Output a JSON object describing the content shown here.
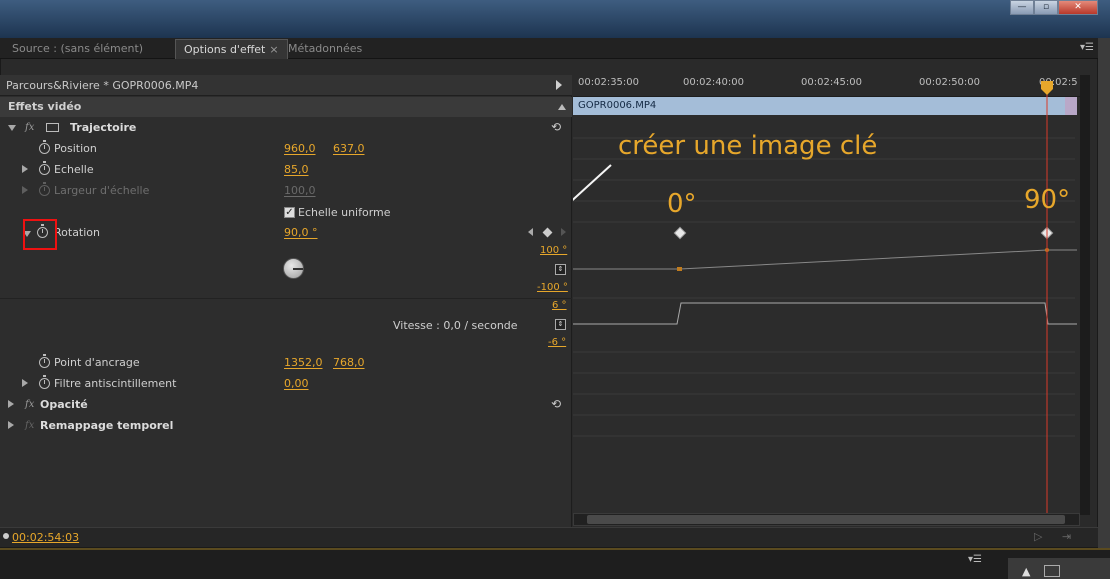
{
  "tabs": [
    {
      "label": "Source : (sans élément)"
    },
    {
      "label": "Options d'effet",
      "close": "×"
    },
    {
      "label": "Métadonnées"
    }
  ],
  "panel_menu": "▾☰",
  "clip_name": "Parcours&Riviere * GOPR0006.MP4",
  "section_header": "Effets vidéo",
  "effects": {
    "trajectoire": {
      "fx": "fx",
      "label": "Trajectoire"
    },
    "position": {
      "label": "Position",
      "x": "960,0",
      "y": "637,0"
    },
    "echelle": {
      "label": "Echelle",
      "value": "85,0"
    },
    "largeur": {
      "label": "Largeur d'échelle",
      "value": "100,0"
    },
    "uniform": {
      "label": "Echelle uniforme",
      "check": "✓"
    },
    "rotation": {
      "label": "Rotation",
      "value": "90,0 °"
    },
    "rotation_axis": {
      "top": "100 °",
      "bottom": "-100 °",
      "vtop": "6 °",
      "vbottom": "-6 °"
    },
    "vitesse": "Vitesse : 0,0 / seconde",
    "ancrage": {
      "label": "Point d'ancrage",
      "x": "1352,0",
      "y": "768,0"
    },
    "antiscint": {
      "label": "Filtre antiscintillement",
      "value": "0,00"
    },
    "opacite": {
      "fx": "fx",
      "label": "Opacité"
    },
    "remappage": {
      "fx": "fx",
      "label": "Remappage temporel"
    }
  },
  "ruler": [
    "00:02:35:00",
    "00:02:40:00",
    "00:02:45:00",
    "00:02:50:00",
    "00:02:5"
  ],
  "timeline_clip": "GOPR0006.MP4",
  "annotation": "créer une image clé",
  "deg_labels": [
    "0°",
    "90°"
  ],
  "timecode": "00:02:54:03",
  "colors": {
    "accent": "#e7a72b",
    "highlight": "#e11111",
    "playhead": "#d83a2a"
  }
}
